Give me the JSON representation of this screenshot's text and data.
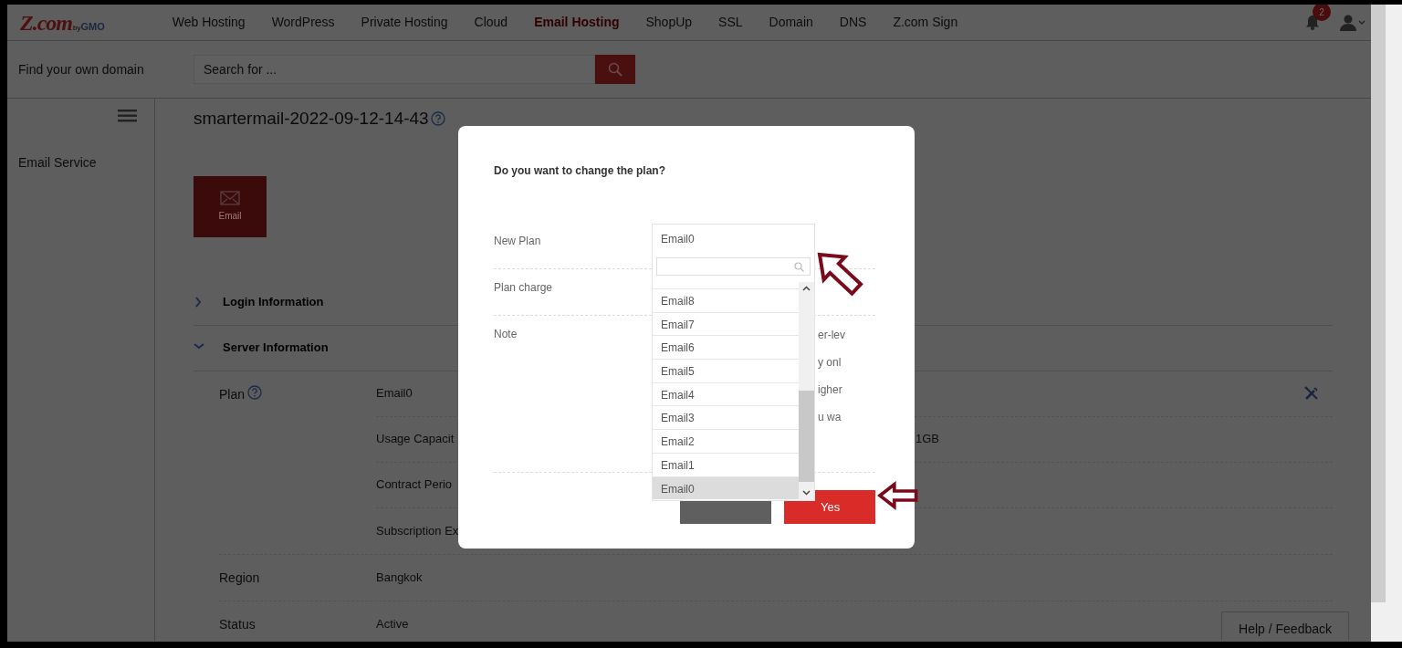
{
  "nav": {
    "logo": {
      "main": "Z.com",
      "by": "by",
      "brand": "GMO"
    },
    "items": [
      {
        "label": "Web Hosting",
        "selected": false
      },
      {
        "label": "WordPress",
        "selected": false
      },
      {
        "label": "Private Hosting",
        "selected": false
      },
      {
        "label": "Cloud",
        "selected": false
      },
      {
        "label": "Email Hosting",
        "selected": true
      },
      {
        "label": "ShopUp",
        "selected": false
      },
      {
        "label": "SSL",
        "selected": false
      },
      {
        "label": "Domain",
        "selected": false
      },
      {
        "label": "DNS",
        "selected": false
      },
      {
        "label": "Z.com Sign",
        "selected": false
      }
    ],
    "notifications": "2"
  },
  "search": {
    "label": "Find your own domain",
    "placeholder": "Search for ..."
  },
  "sidebar": {
    "items": [
      "Email Service"
    ]
  },
  "main": {
    "title": "smartermail-2022-09-12-14-43",
    "tiles": [
      {
        "label": "Email"
      }
    ],
    "sections": [
      {
        "label": "Login Information",
        "expanded": false
      },
      {
        "label": "Server Information",
        "expanded": true
      }
    ],
    "details": [
      {
        "label": "Plan",
        "help": true,
        "rows": [
          {
            "text": "Email0",
            "tool": true
          },
          {
            "text": "Usage Capacit",
            "value": "1GB"
          },
          {
            "text": "Contract Perio"
          },
          {
            "text": "Subscription Ex"
          }
        ]
      },
      {
        "label": "Region",
        "rows": [
          {
            "text": "Bangkok"
          }
        ]
      },
      {
        "label": "Status",
        "rows": [
          {
            "text": "Active"
          }
        ]
      }
    ]
  },
  "help_button": "Help / Feedback",
  "dialog": {
    "title": "Do you want to change the plan?",
    "fields": [
      {
        "label": "New Plan"
      },
      {
        "label": "Plan charge"
      },
      {
        "label": "Note",
        "fragments": [
          "er-lev",
          "y onl",
          "igher",
          "u wa"
        ]
      }
    ],
    "buttons": [
      {
        "kind": "cancel"
      },
      {
        "kind": "confirm",
        "label": "Yes"
      }
    ]
  },
  "dropdown": {
    "value": "Email0",
    "options": [
      {
        "label": "Email8",
        "selected": false
      },
      {
        "label": "Email7",
        "selected": false
      },
      {
        "label": "Email6",
        "selected": false
      },
      {
        "label": "Email5",
        "selected": false
      },
      {
        "label": "Email4",
        "selected": false
      },
      {
        "label": "Email3",
        "selected": false
      },
      {
        "label": "Email2",
        "selected": false
      },
      {
        "label": "Email1",
        "selected": false
      },
      {
        "label": "Email0",
        "selected": true
      }
    ]
  }
}
